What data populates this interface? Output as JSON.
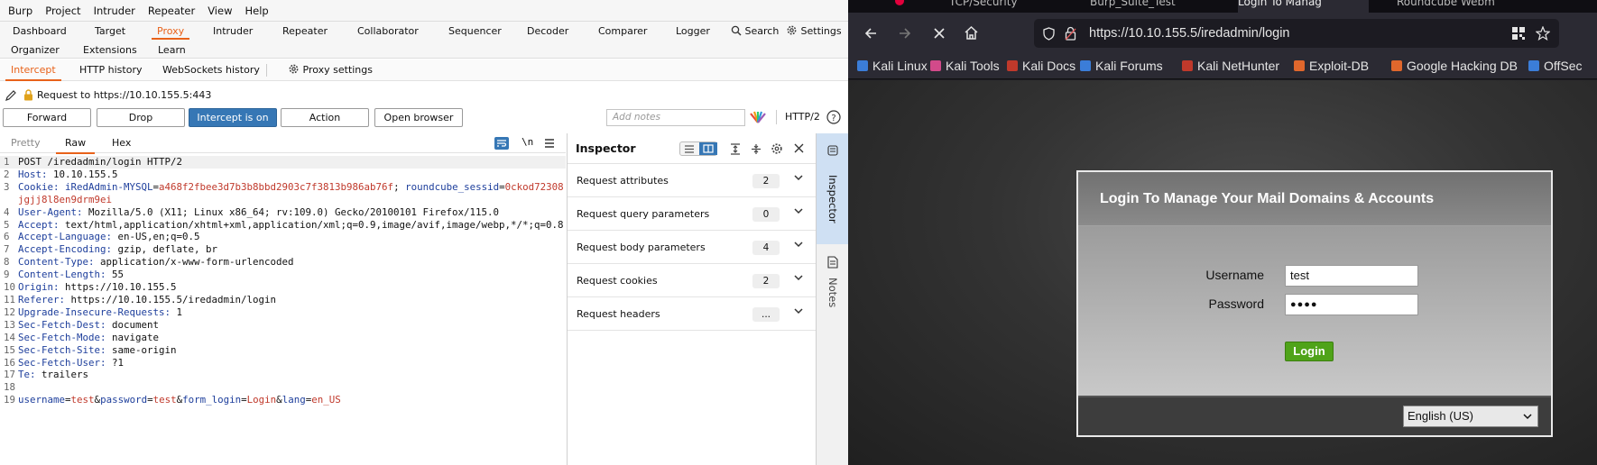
{
  "burp": {
    "menu": [
      "Burp",
      "Project",
      "Intruder",
      "Repeater",
      "View",
      "Help"
    ],
    "top_tabs_row1": [
      "Dashboard",
      "Target",
      "Proxy",
      "Intruder",
      "Repeater",
      "Collaborator",
      "Sequencer",
      "Decoder",
      "Comparer",
      "Logger"
    ],
    "search_label": "Search",
    "settings_label": "Settings",
    "top_tabs_row2": [
      "Organizer",
      "Extensions",
      "Learn"
    ],
    "active_top_tab": "Proxy",
    "sub_tabs": [
      "Intercept",
      "HTTP history",
      "WebSockets history"
    ],
    "proxy_settings_label": "Proxy settings",
    "request_to": "Request to https://10.10.155.5:443",
    "buttons": {
      "forward": "Forward",
      "drop": "Drop",
      "intercept": "Intercept is on",
      "action": "Action",
      "open_browser": "Open browser"
    },
    "notes_placeholder": "Add notes",
    "http_version": "HTTP/2",
    "editor_tabs": [
      "Pretty",
      "Raw",
      "Hex"
    ],
    "newline_toggle": "\\n",
    "request_lines": [
      {
        "n": "1",
        "parts": [
          [
            "sp",
            "POST /iredadmin/login HTTP/2"
          ]
        ]
      },
      {
        "n": "2",
        "parts": [
          [
            "hn",
            "Host: "
          ],
          [
            "hv",
            "10.10.155.5"
          ]
        ]
      },
      {
        "n": "3",
        "parts": [
          [
            "hn",
            "Cookie: "
          ],
          [
            "pk",
            "iRedAdmin-MYSQL"
          ],
          [
            "sp",
            "="
          ],
          [
            "pv",
            "a468f2fbee3d7b3b8bbd2903c7f3813b986ab76f"
          ],
          [
            "sp",
            "; "
          ],
          [
            "pk",
            "roundcube_sessid"
          ],
          [
            "sp",
            "="
          ],
          [
            "pv",
            "0ckod72308jgjj8l8en9drm9ei"
          ]
        ]
      },
      {
        "n": "4",
        "parts": [
          [
            "hn",
            "User-Agent: "
          ],
          [
            "hv",
            "Mozilla/5.0 (X11; Linux x86_64; rv:109.0) Gecko/20100101 Firefox/115.0"
          ]
        ]
      },
      {
        "n": "5",
        "parts": [
          [
            "hn",
            "Accept: "
          ],
          [
            "hv",
            "text/html,application/xhtml+xml,application/xml;q=0.9,image/avif,image/webp,*/*;q=0.8"
          ]
        ]
      },
      {
        "n": "6",
        "parts": [
          [
            "hn",
            "Accept-Language: "
          ],
          [
            "hv",
            "en-US,en;q=0.5"
          ]
        ]
      },
      {
        "n": "7",
        "parts": [
          [
            "hn",
            "Accept-Encoding: "
          ],
          [
            "hv",
            "gzip, deflate, br"
          ]
        ]
      },
      {
        "n": "8",
        "parts": [
          [
            "hn",
            "Content-Type: "
          ],
          [
            "hv",
            "application/x-www-form-urlencoded"
          ]
        ]
      },
      {
        "n": "9",
        "parts": [
          [
            "hn",
            "Content-Length: "
          ],
          [
            "hv",
            "55"
          ]
        ]
      },
      {
        "n": "10",
        "parts": [
          [
            "hn",
            "Origin: "
          ],
          [
            "hv",
            "https://10.10.155.5"
          ]
        ]
      },
      {
        "n": "11",
        "parts": [
          [
            "hn",
            "Referer: "
          ],
          [
            "hv",
            "https://10.10.155.5/iredadmin/login"
          ]
        ]
      },
      {
        "n": "12",
        "parts": [
          [
            "hn",
            "Upgrade-Insecure-Requests: "
          ],
          [
            "hv",
            "1"
          ]
        ]
      },
      {
        "n": "13",
        "parts": [
          [
            "hn",
            "Sec-Fetch-Dest: "
          ],
          [
            "hv",
            "document"
          ]
        ]
      },
      {
        "n": "14",
        "parts": [
          [
            "hn",
            "Sec-Fetch-Mode: "
          ],
          [
            "hv",
            "navigate"
          ]
        ]
      },
      {
        "n": "15",
        "parts": [
          [
            "hn",
            "Sec-Fetch-Site: "
          ],
          [
            "hv",
            "same-origin"
          ]
        ]
      },
      {
        "n": "16",
        "parts": [
          [
            "hn",
            "Sec-Fetch-User: "
          ],
          [
            "hv",
            "?1"
          ]
        ]
      },
      {
        "n": "17",
        "parts": [
          [
            "hn",
            "Te: "
          ],
          [
            "hv",
            "trailers"
          ]
        ]
      },
      {
        "n": "18",
        "parts": [
          [
            "sp",
            ""
          ]
        ]
      },
      {
        "n": "19",
        "parts": [
          [
            "pk",
            "username"
          ],
          [
            "sp",
            "="
          ],
          [
            "pv",
            "test"
          ],
          [
            "sp",
            "&"
          ],
          [
            "pk",
            "password"
          ],
          [
            "sp",
            "="
          ],
          [
            "pv",
            "test"
          ],
          [
            "sp",
            "&"
          ],
          [
            "pk",
            "form_login"
          ],
          [
            "sp",
            "="
          ],
          [
            "pv",
            "Login"
          ],
          [
            "sp",
            "&"
          ],
          [
            "pk",
            "lang"
          ],
          [
            "sp",
            "="
          ],
          [
            "pv",
            "en_US"
          ]
        ]
      }
    ],
    "inspector": {
      "title": "Inspector",
      "sections": [
        {
          "label": "Request attributes",
          "count": "2"
        },
        {
          "label": "Request query parameters",
          "count": "0"
        },
        {
          "label": "Request body parameters",
          "count": "4"
        },
        {
          "label": "Request cookies",
          "count": "2"
        },
        {
          "label": "Request headers",
          "count": "..."
        }
      ]
    },
    "side_panel": {
      "inspector": "Inspector",
      "notes": "Notes"
    }
  },
  "firefox": {
    "tabs": [
      "TCP/Security",
      "Burp_Suite_Test",
      "Login To Manag",
      "Roundcube Webm"
    ],
    "url": "https://10.10.155.5/iredadmin/login",
    "bookmarks": [
      {
        "label": "Kali Linux",
        "color": "#3b7dd8"
      },
      {
        "label": "Kali Tools",
        "color": "#d24a8a"
      },
      {
        "label": "Kali Docs",
        "color": "#c0392b"
      },
      {
        "label": "Kali Forums",
        "color": "#3b7dd8"
      },
      {
        "label": "Kali NetHunter",
        "color": "#c0392b"
      },
      {
        "label": "Exploit-DB",
        "color": "#e0672c"
      },
      {
        "label": "Google Hacking DB",
        "color": "#e0672c"
      },
      {
        "label": "OffSec",
        "color": "#3b7dd8"
      }
    ],
    "login": {
      "title": "Login To Manage Your Mail Domains & Accounts",
      "username_label": "Username",
      "username_value": "test",
      "password_label": "Password",
      "password_value": "●●●●",
      "button": "Login",
      "language": "English (US)"
    }
  }
}
